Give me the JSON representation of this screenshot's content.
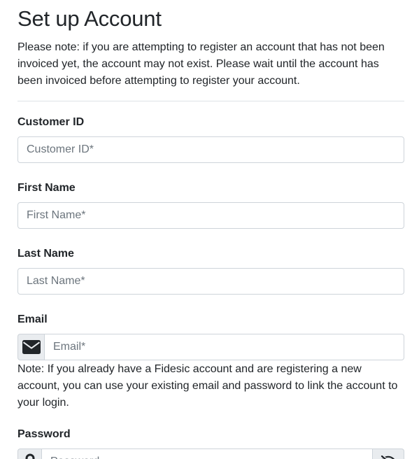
{
  "page": {
    "title": "Set up Account",
    "intro_note": "Please note: if you are attempting to register an account that has not been invoiced yet, the account may not exist. Please wait until the account has been invoiced before attempting to register your account."
  },
  "form": {
    "customer_id": {
      "label": "Customer ID",
      "placeholder": "Customer ID*",
      "value": ""
    },
    "first_name": {
      "label": "First Name",
      "placeholder": "First Name*",
      "value": ""
    },
    "last_name": {
      "label": "Last Name",
      "placeholder": "Last Name*",
      "value": ""
    },
    "email": {
      "label": "Email",
      "placeholder": "Email*",
      "value": "",
      "icon": "envelope-icon",
      "help": "Note: If you already have a Fidesic account and are registering a new account, you can use your existing email and password to link the account to your login."
    },
    "password": {
      "label": "Password",
      "placeholder": "Password",
      "value": "",
      "icon": "lock-icon",
      "toggle_icon": "eye-slash-icon"
    }
  },
  "colors": {
    "text": "#212529",
    "placeholder": "#6c757d",
    "border": "#ced4da",
    "addon_bg": "#e9ecef",
    "divider": "#dee2e6"
  }
}
